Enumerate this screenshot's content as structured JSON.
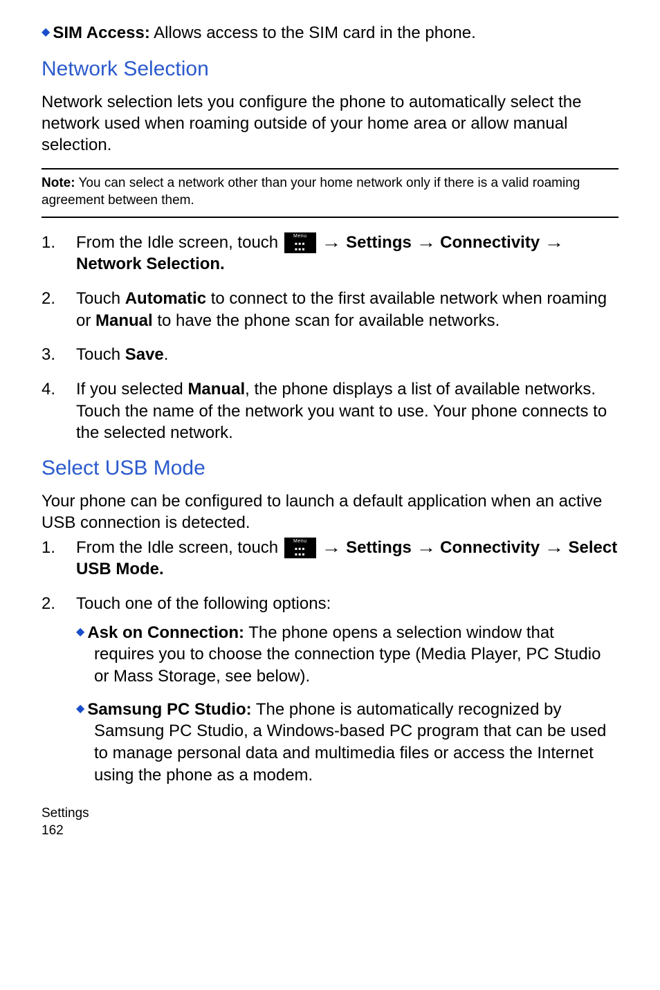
{
  "top_bullet": {
    "label": "SIM Access:",
    "text": " Allows access to the SIM card in the phone."
  },
  "section1": {
    "heading": "Network Selection",
    "intro": "Network selection lets you configure the phone to automatically select the network used when roaming outside of your home area or allow manual selection.",
    "note_label": "Note:",
    "note_text": " You can select a network other than your home network only if there is a valid roaming agreement between them.",
    "steps": {
      "s1a": "From the Idle screen, touch ",
      "s1b": " Settings ",
      "s1c": " Connectivity ",
      "s1d": "Network Selection.",
      "s2a": "Touch ",
      "s2b": "Automatic",
      "s2c": " to connect to the first available network when roaming or ",
      "s2d": "Manual",
      "s2e": " to have the phone scan for available networks.",
      "s3a": "Touch ",
      "s3b": "Save",
      "s3c": ".",
      "s4a": "If you selected ",
      "s4b": "Manual",
      "s4c": ", the phone displays a list of available networks. Touch the name of the network you want to use. Your phone connects to the selected network."
    }
  },
  "section2": {
    "heading": "Select USB Mode",
    "intro": "Your phone can be configured to launch a default application when an active USB connection is detected.",
    "steps": {
      "s1a": "From the Idle screen, touch ",
      "s1b": " Settings ",
      "s1c": " Connectivity ",
      "s1d": "Select USB Mode.",
      "s2": "Touch one of the following options:"
    },
    "bullets": {
      "b1_label": "Ask on Connection:",
      "b1_text": " The phone opens a selection window that requires you to choose the connection type (Media Player, PC Studio or Mass Storage, see below).",
      "b2_label": "Samsung PC Studio:",
      "b2_text": " The phone is automatically recognized by Samsung PC Studio, a Windows-based PC program that can be used to manage personal data and multimedia files or access the Internet using the phone as a modem."
    }
  },
  "footer": {
    "title": "Settings",
    "page": "162"
  },
  "icon": {
    "top": "Menu"
  }
}
